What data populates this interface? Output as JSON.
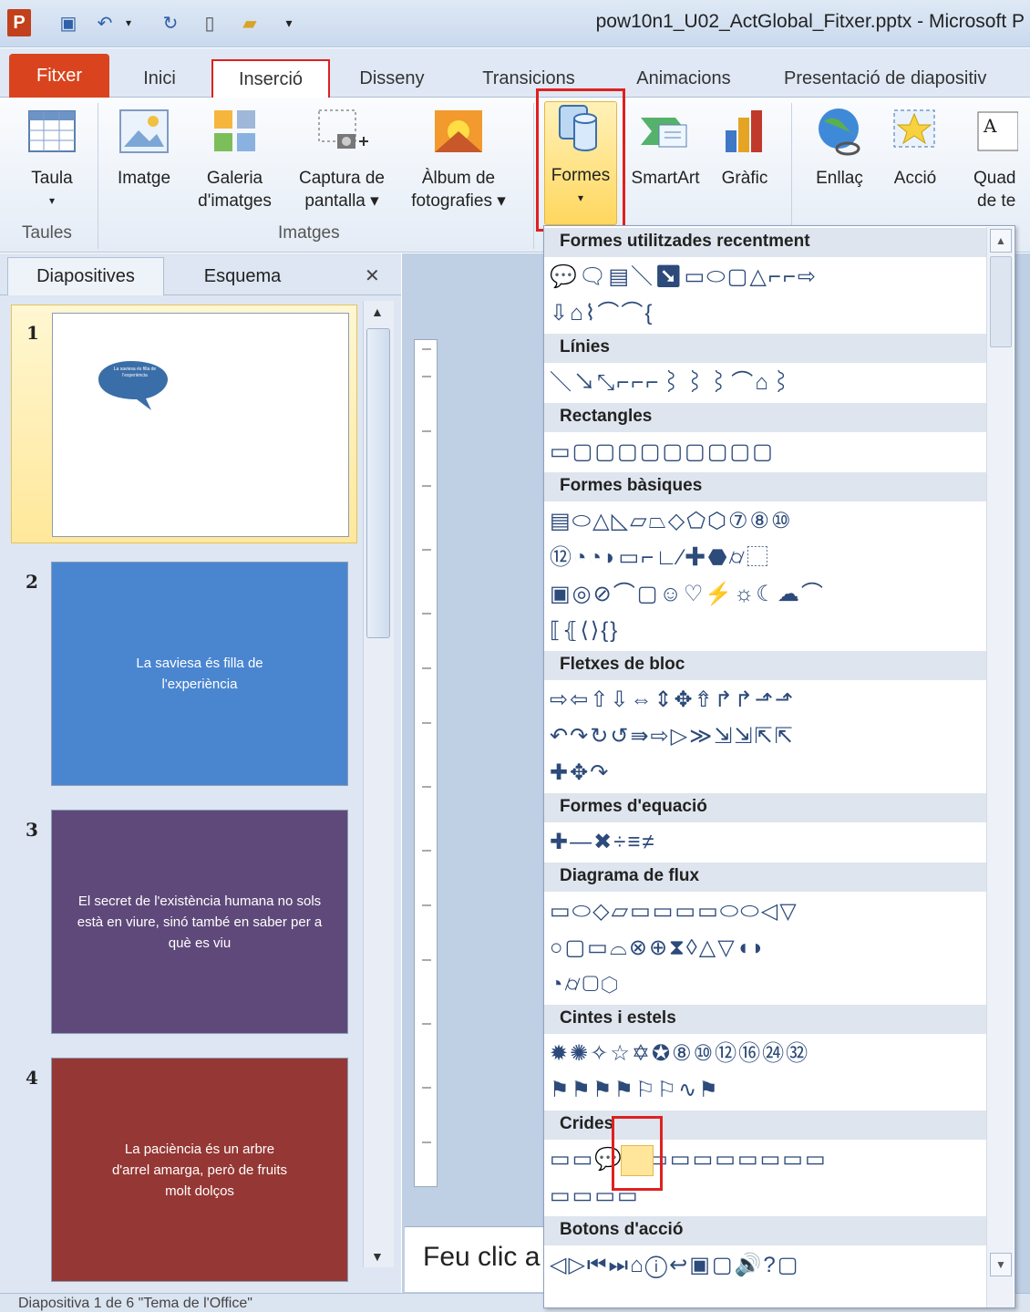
{
  "window": {
    "title": "pow10n1_U02_ActGlobal_Fitxer.pptx - Microsoft P"
  },
  "tabs": {
    "file": "Fitxer",
    "home": "Inici",
    "insert": "Inserció",
    "design": "Disseny",
    "transitions": "Transicions",
    "animations": "Animacions",
    "slideshow": "Presentació de diapositiv"
  },
  "ribbon": {
    "table": "Taula",
    "image": "Imatge",
    "gallery_1": "Galeria",
    "gallery_2": "d'imatges",
    "capture_1": "Captura de",
    "capture_2": "pantalla ▾",
    "album_1": "Àlbum de",
    "album_2": "fotografies ▾",
    "shapes": "Formes",
    "smartart": "SmartArt",
    "chart": "Gràfic",
    "link": "Enllaç",
    "action": "Acció",
    "textbox_1": "Quad",
    "textbox_2": "de te",
    "group_tables": "Taules",
    "group_images": "Imatges"
  },
  "pane": {
    "tab_slides": "Diapositives",
    "tab_outline": "Esquema",
    "close": "✕"
  },
  "slides": [
    {
      "num": "1",
      "color": "#ffffff",
      "callout": "La saviesa és filla de l'experiència"
    },
    {
      "num": "2",
      "color": "#4a86d0",
      "text": "La saviesa és filla de l'experiència"
    },
    {
      "num": "3",
      "color": "#5f497a",
      "text": "El secret de l'existència humana no sols està en viure, sinó també en saber per a què es viu"
    },
    {
      "num": "4",
      "color": "#953734",
      "text": "La paciència és un arbre d'arrel amarga, però de fruits molt dolços"
    }
  ],
  "notes": {
    "placeholder": "Feu clic a"
  },
  "status": {
    "text": "Diapositiva 1 de 6    \"Tema de l'Office\""
  },
  "shapes_menu": {
    "categories": [
      "Formes utilitzades recentment",
      "Línies",
      "Rectangles",
      "Formes bàsiques",
      "Fletxes de bloc",
      "Formes d'equació",
      "Diagrama de flux",
      "Cintes i estels",
      "Crides",
      "Botons d'acció"
    ],
    "rows": [
      "💬🗨▤＼↘▭⬭▢△⌐⌐⇨",
      "⇩⌂⌇⌒⌒{",
      "＼↘⤡⌐⌐⌐⌇⌇⌇⌒⌂⌇",
      "▭▢▢▢▢▢▢▢▢▢",
      "▤⬭△◺▱⏢◇⬠⬡⑦⑧⑩",
      "⑫◔◔◗▭⌐∟⁄✚⬣⌭⬚",
      "▣◎⊘⌒▢☺♡⚡☼☾☁⌒",
      "⟦⦃⟨⟩{}",
      "⇨⇦⇧⇩⇔⇕✥⇮↱↱⬏⬏",
      "↶↷↻↺⇛⇨▷≫⇲⇲⇱⇱",
      "✚✥↷",
      "✚―✖÷≡≠",
      "▭⬭◇▱▭▭▭▭⬭⬭◁▽",
      "○▢▭⌓⊗⊕⧗◊△▽◖◗",
      "◔⌭▢⬡",
      "✹✺✧☆✡✪⑧⑩⑫⑯㉔㉜",
      "⚑⚑⚑⚑⚐⚐∿⚑",
      "▭▭💬☁▭▭▭▭▭▭▭▭",
      "▭▭▭▭",
      "◁▷⏮⏭⌂ⓘ↩▣▢🔊?▢"
    ]
  }
}
